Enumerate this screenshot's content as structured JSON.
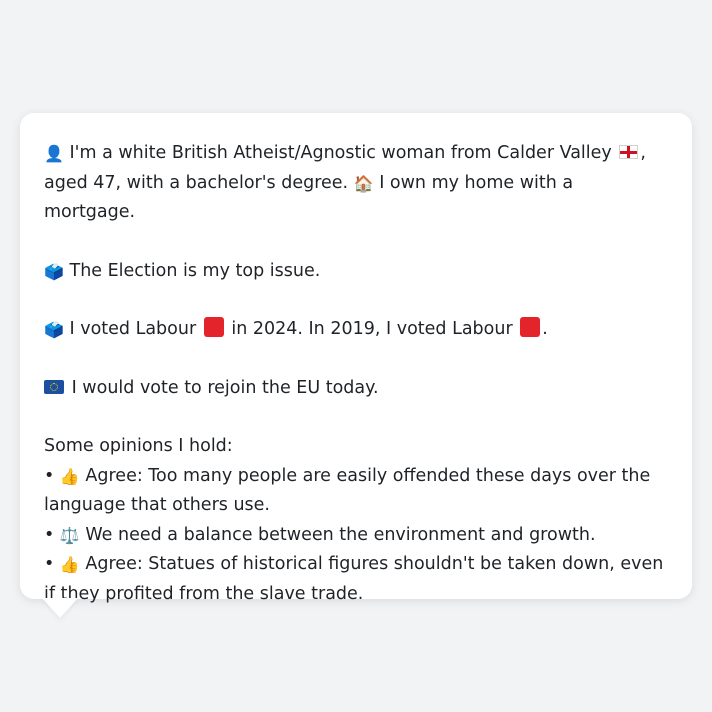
{
  "colors": {
    "background": "#f1f3f5",
    "card": "#ffffff",
    "text": "#1f2328",
    "labour_red": "#e3242b",
    "eu_blue": "#1d4fa0"
  },
  "profile": {
    "intro": {
      "icon": "person-silhouette-icon",
      "text_before_flag": "I'm a white British Atheist/Agnostic woman from Calder Valley",
      "flag": "england-flag-icon",
      "text_after_flag": ", aged 47, with a bachelor's degree.",
      "home_icon": "house-icon",
      "home_text": "I own my home with a mortgage."
    },
    "top_issue": {
      "icon": "ballot-box-icon",
      "text": "The Election is my top issue."
    },
    "votes": {
      "icon": "ballot-box-icon",
      "text_2024": "I voted Labour",
      "text_2024_suffix": "in 2024. In 2019, I voted Labour",
      "text_end": "."
    },
    "eu": {
      "icon": "eu-flag-icon",
      "text": "I would vote to rejoin the EU today."
    },
    "opinions_heading": "Some opinions I hold:",
    "opinions": [
      {
        "bullet": "•",
        "icon": "thumbs-up-icon",
        "glyph": "👍",
        "text": "Agree: Too many people are easily offended these days over the language that others use."
      },
      {
        "bullet": "•",
        "icon": "balance-scale-icon",
        "glyph": "⚖️",
        "text": "We need a balance between the environment and growth."
      },
      {
        "bullet": "•",
        "icon": "thumbs-up-icon",
        "glyph": "👍",
        "text": "Agree: Statues of historical figures shouldn't be taken down, even if they profited from the slave trade."
      }
    ]
  },
  "glyphs": {
    "person": "👤",
    "house": "🏠",
    "ballot": "🗳️"
  }
}
